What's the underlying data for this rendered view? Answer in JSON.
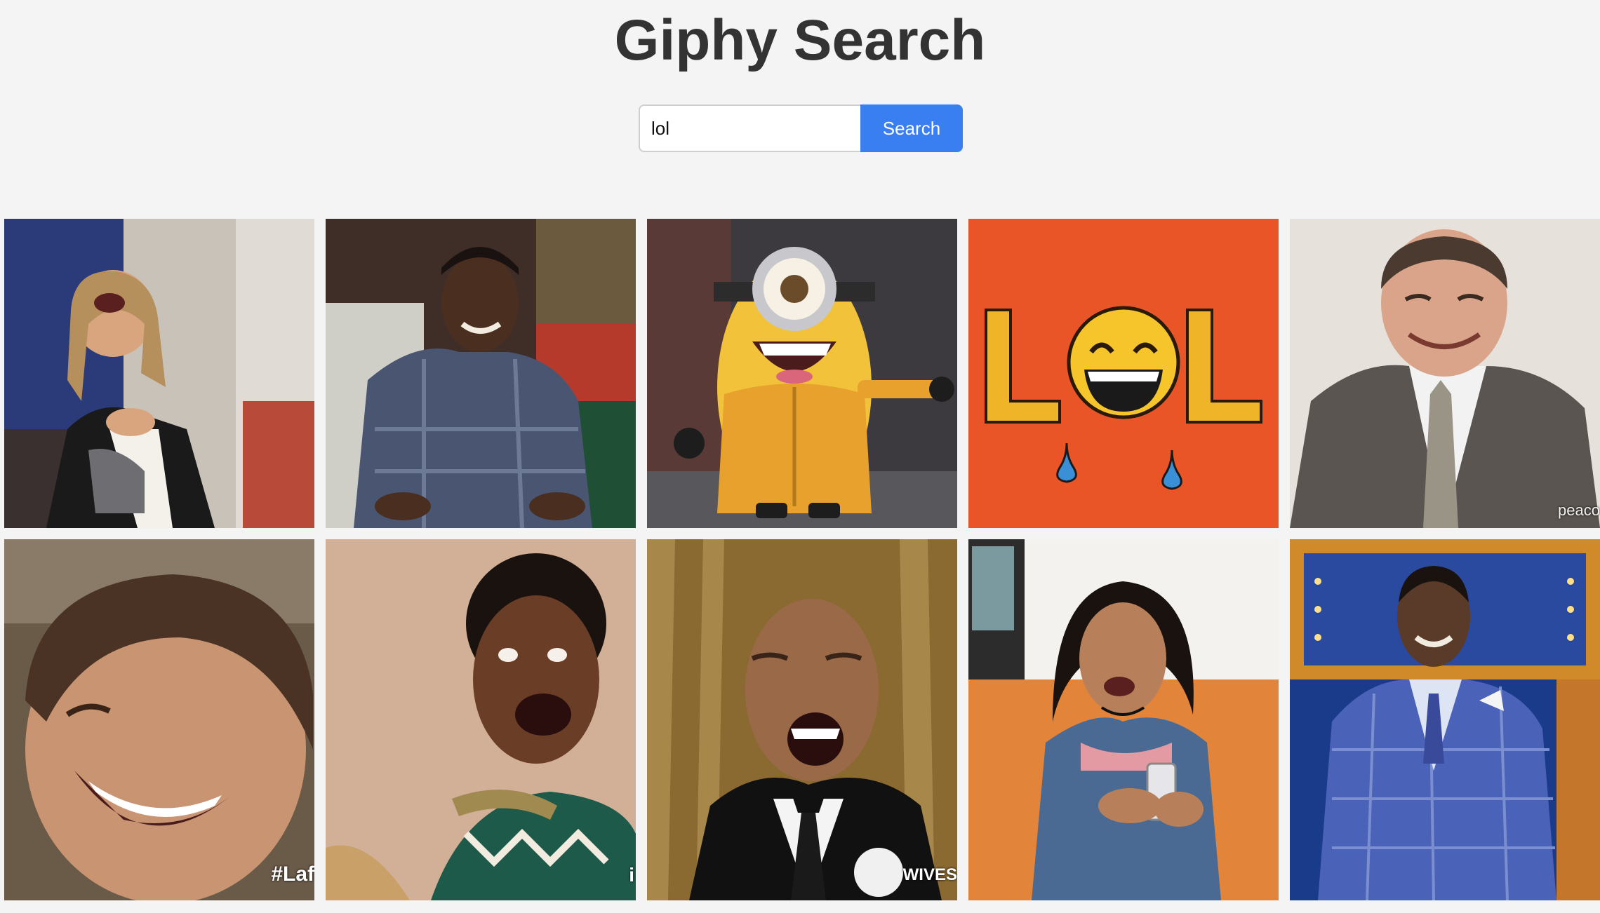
{
  "header": {
    "title": "Giphy Search"
  },
  "search": {
    "value": "lol",
    "button_label": "Search"
  },
  "results": [
    {
      "id": "laughing-woman-blonde",
      "overlay": ""
    },
    {
      "id": "smiling-man-plaid-shirt",
      "overlay": ""
    },
    {
      "id": "laughing-minion",
      "overlay": ""
    },
    {
      "id": "lol-emoji-text",
      "overlay": ""
    },
    {
      "id": "laughing-bald-man-office",
      "overlay": "peaco"
    },
    {
      "id": "laughing-young-man",
      "overlay": "#Laf"
    },
    {
      "id": "laughing-woman-curly-hair",
      "overlay": "i"
    },
    {
      "id": "laughing-man-tuxedo",
      "overlay": "WIVES"
    },
    {
      "id": "laughing-woman-phone",
      "overlay": ""
    },
    {
      "id": "laughing-man-blue-suit",
      "overlay": ""
    }
  ],
  "colors": {
    "background": "#f4f4f4",
    "title": "#333333",
    "accent": "#3a7ff2",
    "lol_background": "#ea5527",
    "lol_letters": "#f0b429"
  }
}
